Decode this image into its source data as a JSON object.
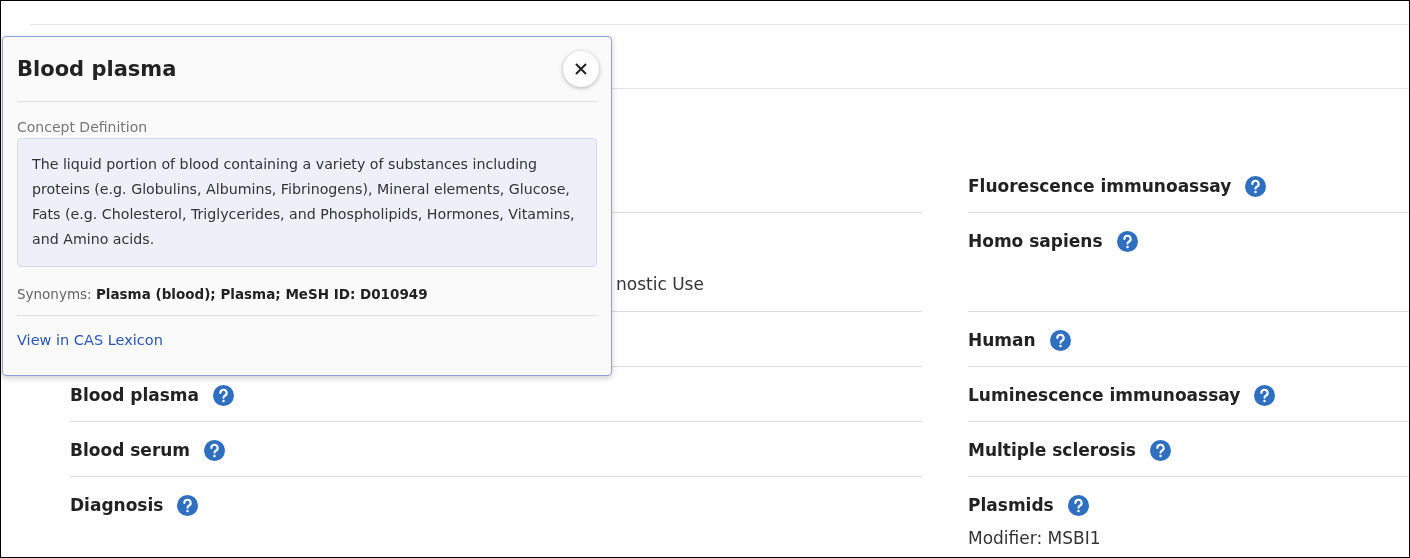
{
  "popup": {
    "title": "Blood plasma",
    "section_label": "Concept Definition",
    "definition": "The liquid portion of blood containing a variety of substances including proteins (e.g. Globulins, Albumins, Fibrinogens), Mineral elements, Glucose, Fats (e.g. Cholesterol, Triglycerides, and Phospholipids, Hormones, Vitamins, and Amino acids.",
    "synonyms_label": "Synonyms:",
    "synonyms": "Plasma (blood); Plasma; MeSH ID: D010949",
    "link": "View in CAS Lexicon"
  },
  "rows": [
    {
      "right": {
        "name": "Fluorescence immunoassay"
      }
    },
    {
      "left": {
        "modifier": "nostic Use"
      },
      "right": {
        "name": "Homo sapiens"
      }
    },
    {
      "right": {
        "name": "Human"
      }
    },
    {
      "left": {
        "name": "Blood plasma"
      },
      "right": {
        "name": "Luminescence immunoassay"
      }
    },
    {
      "left": {
        "name": "Blood serum"
      },
      "right": {
        "name": "Multiple sclerosis"
      }
    },
    {
      "left": {
        "name": "Diagnosis"
      },
      "right": {
        "name": "Plasmids",
        "modifier": "Modifier: MSBI1"
      }
    }
  ]
}
